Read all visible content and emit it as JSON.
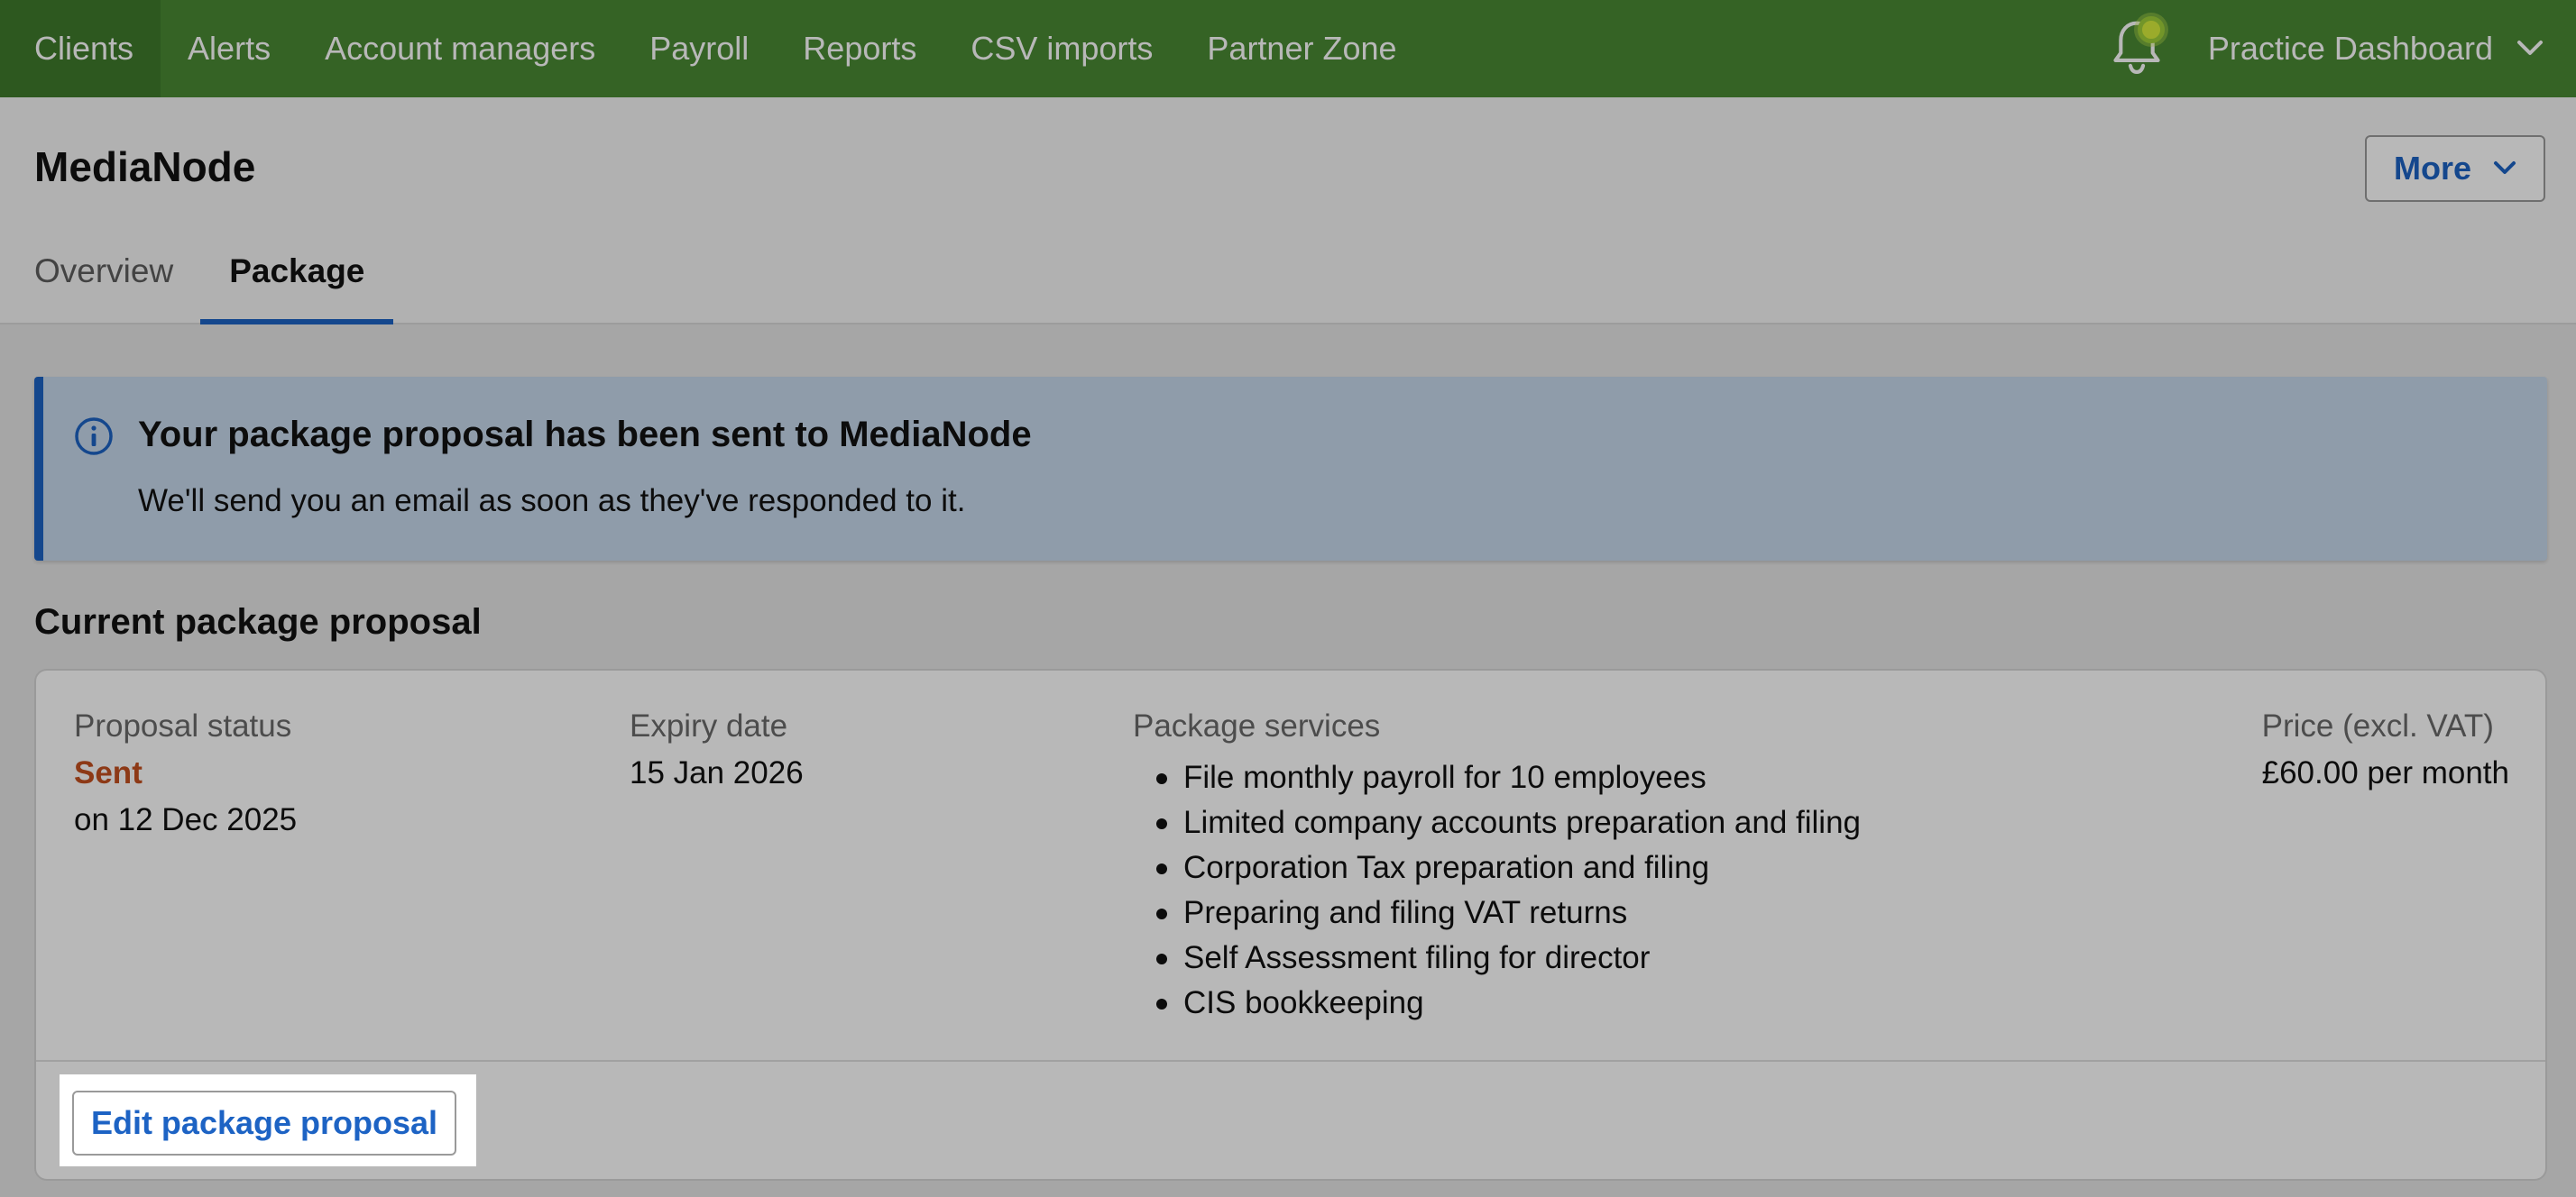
{
  "nav": {
    "items": [
      {
        "label": "Clients"
      },
      {
        "label": "Alerts"
      },
      {
        "label": "Account managers"
      },
      {
        "label": "Payroll"
      },
      {
        "label": "Reports"
      },
      {
        "label": "CSV imports"
      },
      {
        "label": "Partner Zone"
      }
    ],
    "practice_label": "Practice Dashboard"
  },
  "page": {
    "title": "MediaNode",
    "more_label": "More",
    "tabs": [
      {
        "label": "Overview"
      },
      {
        "label": "Package"
      }
    ]
  },
  "banner": {
    "title": "Your package proposal has been sent to MediaNode",
    "text": "We'll send you an email as soon as they've responded to it."
  },
  "proposal": {
    "section_title": "Current package proposal",
    "status_label": "Proposal status",
    "status_value": "Sent",
    "status_date": "on 12 Dec 2025",
    "expiry_label": "Expiry date",
    "expiry_value": "15 Jan 2026",
    "services_label": "Package services",
    "services": [
      "File monthly payroll for 10 employees",
      "Limited company accounts preparation and filing",
      "Corporation Tax preparation and filing",
      "Preparing and filing VAT returns",
      "Self Assessment filing for director",
      "CIS bookkeeping"
    ],
    "price_label": "Price (excl. VAT)",
    "price_value": "£60.00 per month",
    "edit_label": "Edit package proposal"
  },
  "colors": {
    "nav_green": "#4a8a34",
    "accent_blue": "#1d63c4",
    "status_orange": "#c4501f"
  },
  "icons": {
    "bell": "bell-icon",
    "chevron": "chevron-down-icon",
    "info": "info-icon"
  }
}
